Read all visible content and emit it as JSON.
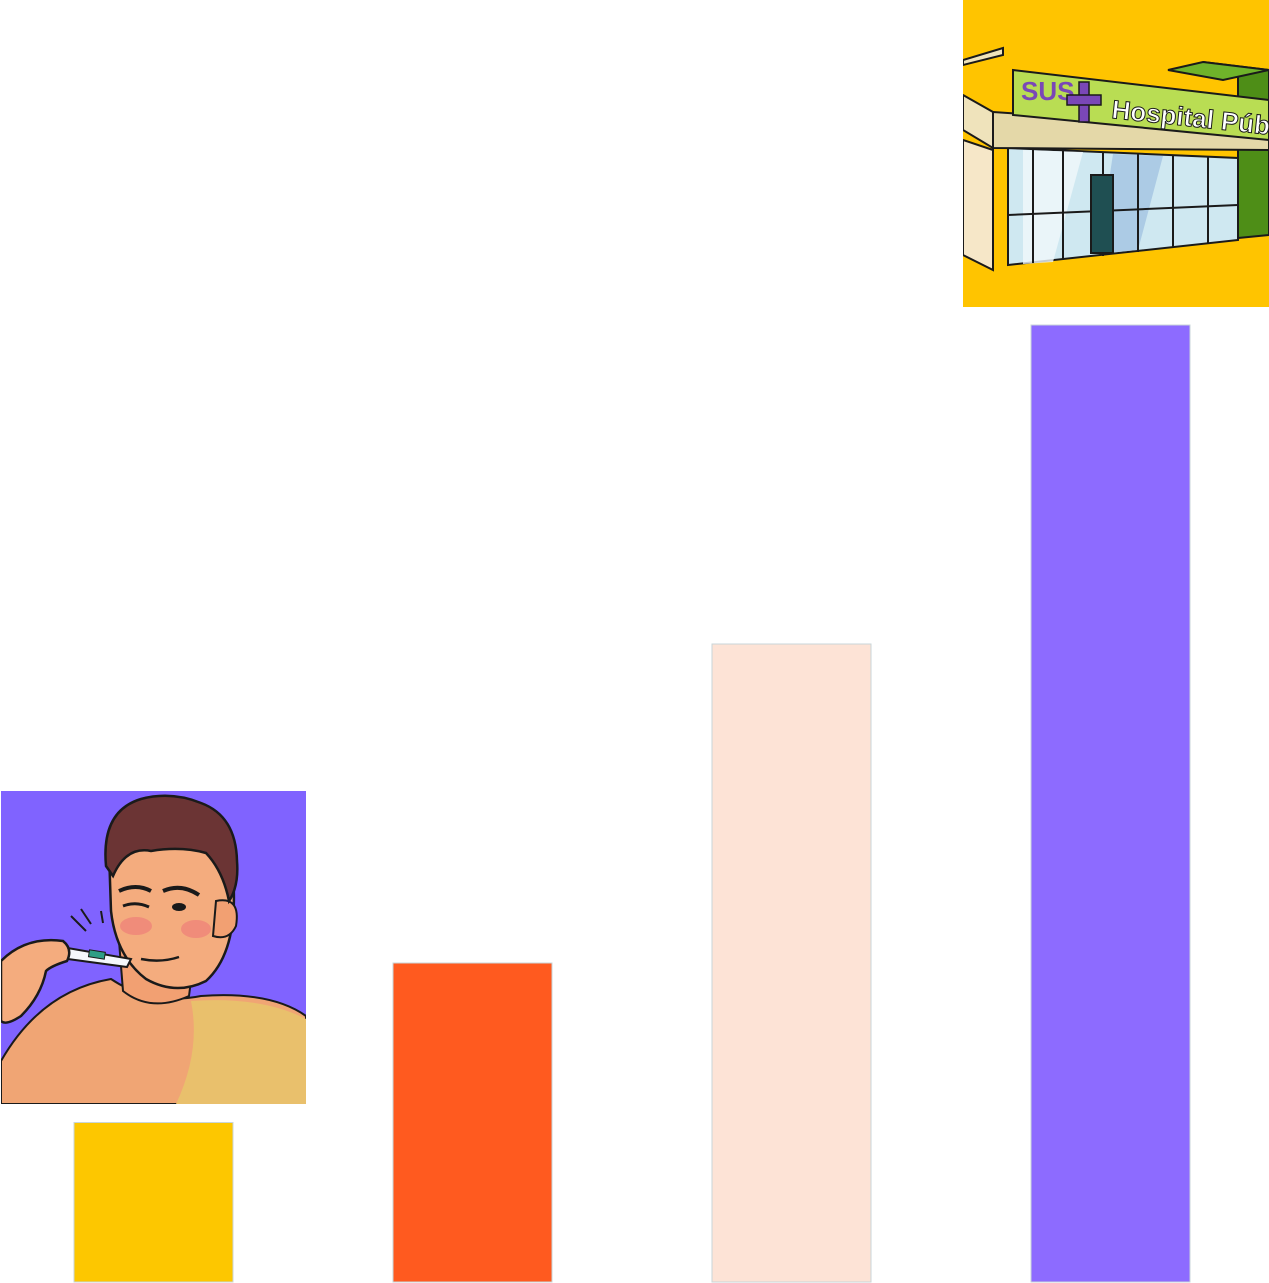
{
  "chart_data": {
    "type": "bar",
    "categories": [
      "",
      "",
      "",
      ""
    ],
    "values": [
      1,
      2,
      4,
      6
    ],
    "ylim": [
      0,
      6
    ],
    "grid": false,
    "legend": "none",
    "bar_colors": [
      "#FDC700",
      "#FF5A1F",
      "#FDE3D6",
      "#8D6BFF"
    ],
    "bar_border": "#c9d6d8"
  },
  "illustrations": {
    "sick_person": {
      "background": "#8063FF",
      "skin": "#F2A072",
      "shirt": "#E9C06C",
      "hair": "#6B3434",
      "thermometer": "#F4F8FB"
    },
    "hospital": {
      "background": "#FFC400",
      "sign": "#B9DD53",
      "sign_text": "SUS",
      "sign_title": "Hospital Públi",
      "glass": "#CFE8F1",
      "green_wall": "#4E8E17",
      "cross": "#7A47B7"
    }
  }
}
